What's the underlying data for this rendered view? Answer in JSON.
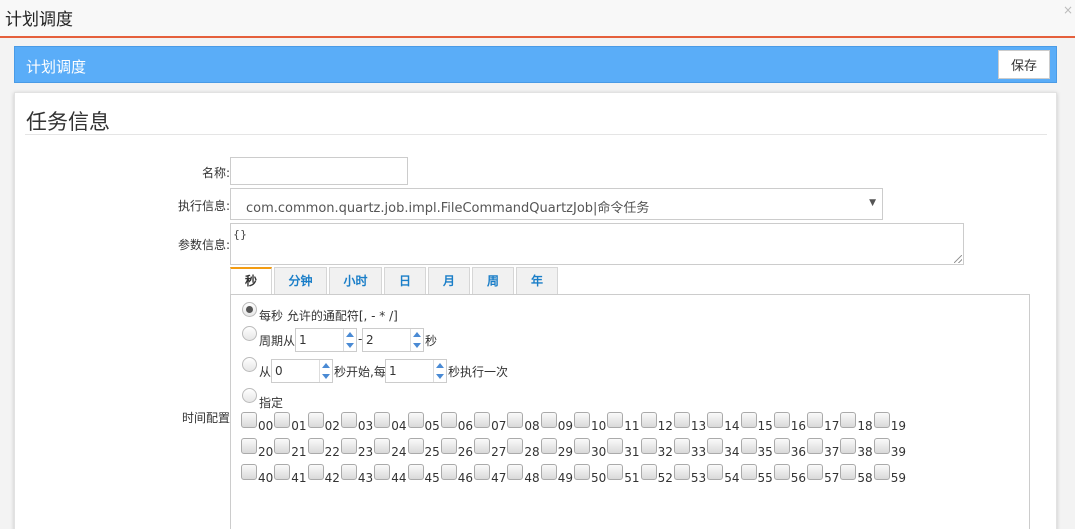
{
  "window": {
    "title": "计划调度",
    "close_glyph": "×"
  },
  "panel": {
    "title": "计划调度",
    "save_label": "保存"
  },
  "section": {
    "title": "任务信息"
  },
  "form": {
    "name_label": "名称:",
    "name_value": "",
    "exec_label": "执行信息:",
    "exec_value": "com.common.quartz.job.impl.FileCommandQuartzJob|命令任务",
    "param_label": "参数信息:",
    "param_value": "{}",
    "time_label": "时间配置"
  },
  "tabs": [
    "秒",
    "分钟",
    "小时",
    "日",
    "月",
    "周",
    "年"
  ],
  "active_tab": 0,
  "options": {
    "every": "每秒 允许的通配符[, - * /]",
    "period_prefix": "周期从",
    "period_dash": "-",
    "period_suffix": "秒",
    "period_from": "1",
    "period_to": "2",
    "start_prefix": "从",
    "start_mid": "秒开始,每",
    "start_suffix": "秒执行一次",
    "start_from": "0",
    "start_every": "1",
    "specify": "指定"
  },
  "selected_option": 0,
  "seconds": [
    "00",
    "01",
    "02",
    "03",
    "04",
    "05",
    "06",
    "07",
    "08",
    "09",
    "10",
    "11",
    "12",
    "13",
    "14",
    "15",
    "16",
    "17",
    "18",
    "19",
    "20",
    "21",
    "22",
    "23",
    "24",
    "25",
    "26",
    "27",
    "28",
    "29",
    "30",
    "31",
    "32",
    "33",
    "34",
    "35",
    "36",
    "37",
    "38",
    "39",
    "40",
    "41",
    "42",
    "43",
    "44",
    "45",
    "46",
    "47",
    "48",
    "49",
    "50",
    "51",
    "52",
    "53",
    "54",
    "55",
    "56",
    "57",
    "58",
    "59"
  ]
}
